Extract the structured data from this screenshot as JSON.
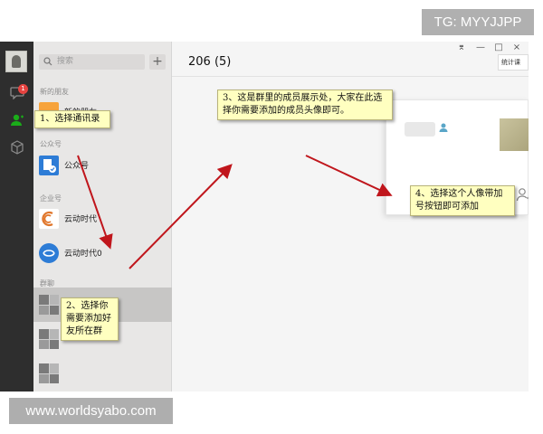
{
  "watermark_top": "TG: MYYJJPP",
  "watermark_bottom": "www.worldsyabo.com",
  "rail": {
    "icons": [
      "user-avatar",
      "chat-icon",
      "contacts-icon",
      "cube-icon"
    ],
    "chat_badge": "1",
    "active_color": "#1aad19"
  },
  "contacts": {
    "search_placeholder": "搜索",
    "add_label": "+",
    "sections": {
      "new_friends": "新的朋友",
      "official": "公众号",
      "enterprise": "企业号",
      "groups": "群聊"
    },
    "new_friend_item": "新的朋友",
    "official_item": "公众号",
    "enterprise_items": [
      "云动时代",
      "云动时代0"
    ]
  },
  "main": {
    "title": "206 (5)",
    "window_buttons": [
      "⌆",
      "—",
      "□",
      "×"
    ],
    "side_tab": "统计课"
  },
  "annotations": {
    "note1": "1、选择通讯录",
    "note2": "2、选择你需要添加好友所在群",
    "note3": "3、这是群里的成员展示处，大家在此选择你需要添加的成员头像即可。",
    "note4": "4、选择这个人像带加号按钮即可添加"
  },
  "colors": {
    "note_bg": "#ffffc0",
    "arrow": "#c0161c",
    "rail_bg": "#2e2e2e",
    "panel_bg": "#e8e7e6"
  }
}
